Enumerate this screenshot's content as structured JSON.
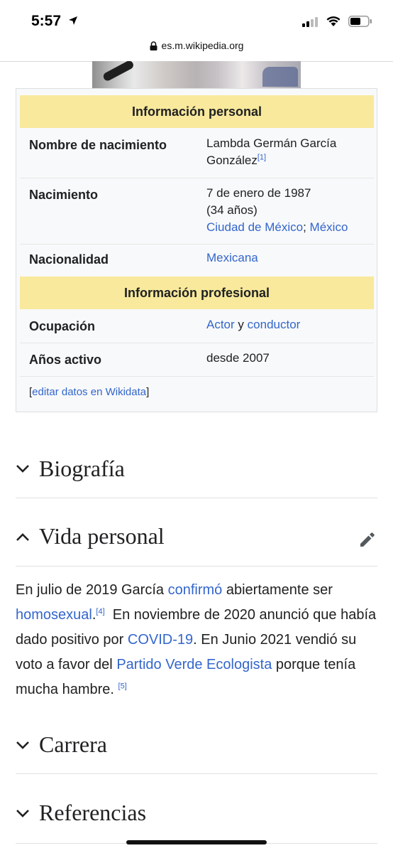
{
  "status": {
    "time": "5:57"
  },
  "browser": {
    "url": "es.m.wikipedia.org"
  },
  "infobox": {
    "personal_header": "Información personal",
    "rows_personal": [
      {
        "label": "Nombre de nacimiento",
        "value_line1": "Lambda Germán García",
        "value_line2": "González",
        "ref": "[1]"
      },
      {
        "label": "Nacimiento",
        "line1": "7 de enero de 1987",
        "line2": "(34 años)",
        "city": "Ciudad de México",
        "sep": ";",
        "country": "México"
      },
      {
        "label": "Nacionalidad",
        "value": "Mexicana"
      }
    ],
    "professional_header": "Información profesional",
    "rows_professional": [
      {
        "label": "Ocupación",
        "link1": "Actor",
        "conj": "y",
        "link2": "conductor"
      },
      {
        "label": "Años activo",
        "value": "desde 2007"
      }
    ],
    "wikidata": {
      "open": "[",
      "link": "editar datos en Wikidata",
      "close": "]"
    }
  },
  "sections": {
    "biografia": "Biografía",
    "vida_personal": "Vida personal",
    "carrera": "Carrera",
    "referencias": "Referencias"
  },
  "paragraph": {
    "t1": "En julio de 2019 García ",
    "l1": "confirmó",
    "t2": " abiertamente ser ",
    "l2": "homosexual",
    "t3": ".",
    "ref4": "[4]",
    "t4": "  En noviembre de 2020 anunció que había dado positivo por ",
    "l3": "COVID-19",
    "t5": ". En Junio 2021 vendió su voto a favor del ",
    "l4": "Partido Verde Ecologista",
    "t6": " porque tenía mucha hambre. ",
    "ref5": "[5]"
  },
  "colors": {
    "link": "#3366cc",
    "infobox_header_bg": "#f8e99c",
    "infobox_bg": "#f8f9fa"
  },
  "icons": [
    "location-arrow-icon",
    "cellular-signal-icon",
    "wifi-icon",
    "battery-icon",
    "lock-icon",
    "chevron-down-icon",
    "chevron-up-icon",
    "pencil-edit-icon"
  ]
}
